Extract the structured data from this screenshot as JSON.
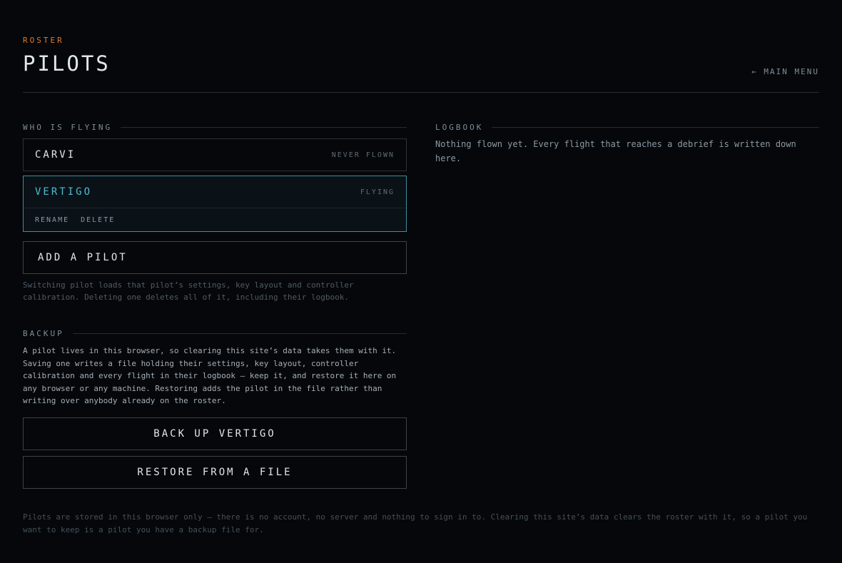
{
  "header": {
    "kicker": "ROSTER",
    "title": "PILOTS",
    "main_menu": "← MAIN MENU"
  },
  "pilots_section": {
    "heading": "WHO IS FLYING",
    "pilots": [
      {
        "name": "CARVI",
        "status": "NEVER FLOWN",
        "active": false
      },
      {
        "name": "VERTIGO",
        "status": "FLYING",
        "active": true
      }
    ],
    "actions": {
      "rename": "RENAME",
      "delete": "DELETE"
    },
    "add_button": "ADD A PILOT",
    "note": "Switching pilot loads that pilot’s settings, key layout and controller calibration. Deleting one deletes all of it, including their logbook."
  },
  "backup_section": {
    "heading": "BACKUP",
    "text": "A pilot lives in this browser, so clearing this site’s data takes them with it. Saving one writes a file holding their settings, key layout, controller calibration and every flight in their logbook — keep it, and restore it here on any browser or any machine. Restoring adds the pilot in the file rather than writing over anybody already on the roster.",
    "backup_button": "BACK UP VERTIGO",
    "restore_button": "RESTORE FROM A FILE"
  },
  "logbook": {
    "heading": "LOGBOOK",
    "empty_text": "Nothing flown yet. Every flight that reaches a debrief is written down here."
  },
  "footer": {
    "text": "Pilots are stored in this browser only — there is no account, no server and nothing to sign in to. Clearing this site’s data clears the roster with it, so a pilot you want to keep is a pilot you have a backup file for."
  },
  "colors": {
    "background": "#05070a",
    "accent_orange": "#e07a2e",
    "accent_cyan": "#4fbad0",
    "active_border": "#3e8e9c"
  }
}
